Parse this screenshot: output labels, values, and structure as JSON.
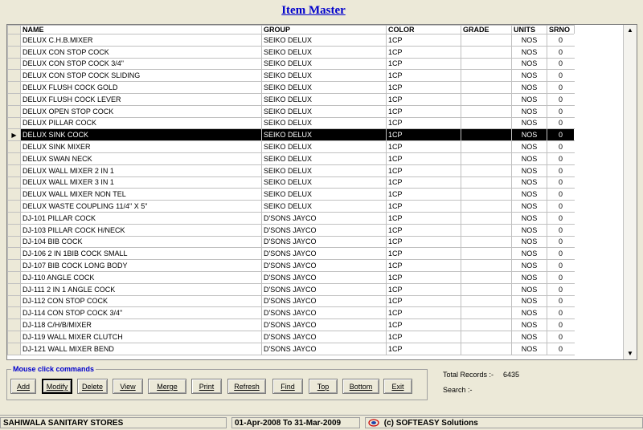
{
  "title": "Item Master",
  "columns": [
    "NAME",
    "GROUP",
    "COLOR",
    "GRADE",
    "UNITS",
    "SRNO"
  ],
  "rows": [
    [
      "DELUX C.H.B.MIXER",
      "SEIKO DELUX",
      "1CP",
      "",
      "NOS",
      "0"
    ],
    [
      "DELUX CON STOP COCK",
      "SEIKO DELUX",
      "1CP",
      "",
      "NOS",
      "0"
    ],
    [
      "DELUX CON STOP COCK  3/4\"",
      "SEIKO DELUX",
      "1CP",
      "",
      "NOS",
      "0"
    ],
    [
      "DELUX CON STOP COCK  SLIDING",
      "SEIKO DELUX",
      "1CP",
      "",
      "NOS",
      "0"
    ],
    [
      "DELUX FLUSH COCK GOLD",
      "SEIKO DELUX",
      "1CP",
      "",
      "NOS",
      "0"
    ],
    [
      "DELUX FLUSH COCK LEVER",
      "SEIKO DELUX",
      "1CP",
      "",
      "NOS",
      "0"
    ],
    [
      "DELUX OPEN STOP COCK",
      "SEIKO DELUX",
      "1CP",
      "",
      "NOS",
      "0"
    ],
    [
      "DELUX PILLAR COCK",
      "SEIKO DELUX",
      "1CP",
      "",
      "NOS",
      "0"
    ],
    [
      "DELUX SINK COCK",
      "SEIKO DELUX",
      "1CP",
      "",
      "NOS",
      "0"
    ],
    [
      "DELUX SINK MIXER",
      "SEIKO DELUX",
      "1CP",
      "",
      "NOS",
      "0"
    ],
    [
      "DELUX SWAN NECK",
      "SEIKO DELUX",
      "1CP",
      "",
      "NOS",
      "0"
    ],
    [
      "DELUX WALL MIXER 2 IN 1",
      "SEIKO DELUX",
      "1CP",
      "",
      "NOS",
      "0"
    ],
    [
      "DELUX WALL MIXER 3 IN 1",
      "SEIKO DELUX",
      "1CP",
      "",
      "NOS",
      "0"
    ],
    [
      "DELUX WALL MIXER NON TEL",
      "SEIKO DELUX",
      "1CP",
      "",
      "NOS",
      "0"
    ],
    [
      "DELUX WASTE COUPLING 11/4\" X 5\"",
      "SEIKO DELUX",
      "1CP",
      "",
      "NOS",
      "0"
    ],
    [
      "DJ-101 PILLAR COCK",
      "D'SONS JAYCO",
      "1CP",
      "",
      "NOS",
      "0"
    ],
    [
      "DJ-103 PILLAR COCK H/NECK",
      "D'SONS JAYCO",
      "1CP",
      "",
      "NOS",
      "0"
    ],
    [
      "DJ-104 BIB COCK",
      "D'SONS JAYCO",
      "1CP",
      "",
      "NOS",
      "0"
    ],
    [
      "DJ-106 2 IN 1BIB COCK  SMALL",
      "D'SONS JAYCO",
      "1CP",
      "",
      "NOS",
      "0"
    ],
    [
      "DJ-107 BIB COCK LONG BODY",
      "D'SONS JAYCO",
      "1CP",
      "",
      "NOS",
      "0"
    ],
    [
      "DJ-110 ANGLE COCK",
      "D'SONS JAYCO",
      "1CP",
      "",
      "NOS",
      "0"
    ],
    [
      "DJ-111 2 IN 1 ANGLE COCK",
      "D'SONS JAYCO",
      "1CP",
      "",
      "NOS",
      "0"
    ],
    [
      "DJ-112 CON STOP COCK",
      "D'SONS JAYCO",
      "1CP",
      "",
      "NOS",
      "0"
    ],
    [
      "DJ-114 CON STOP COCK 3/4\"",
      "D'SONS JAYCO",
      "1CP",
      "",
      "NOS",
      "0"
    ],
    [
      "DJ-118 C/H/B/MIXER",
      "D'SONS JAYCO",
      "1CP",
      "",
      "NOS",
      "0"
    ],
    [
      "DJ-119 WALL MIXER CLUTCH",
      "D'SONS JAYCO",
      "1CP",
      "",
      "NOS",
      "0"
    ],
    [
      "DJ-121 WALL MIXER BEND",
      "D'SONS JAYCO",
      "1CP",
      "",
      "NOS",
      "0"
    ]
  ],
  "selected_row": 8,
  "commands_label": "Mouse click commands",
  "buttons": [
    "Add",
    "Modify",
    "Delete",
    "View",
    "Merge",
    "Print",
    "Refresh",
    "Find",
    "Top",
    "Bottom",
    "Exit"
  ],
  "active_button": "Modify",
  "total_records_label": "Total Records :-",
  "total_records_value": "6435",
  "search_label": "Search :-",
  "status": {
    "company": "SAHIWALA SANITARY STORES",
    "period": "01-Apr-2008 To 31-Mar-2009",
    "copyright": "(c) SOFTEASY Solutions"
  },
  "icons": {
    "row_indicator": "triangle-right-icon",
    "scroll_up": "arrow-up-icon",
    "scroll_down": "arrow-down-icon",
    "logo": "softeasy-logo-icon"
  }
}
